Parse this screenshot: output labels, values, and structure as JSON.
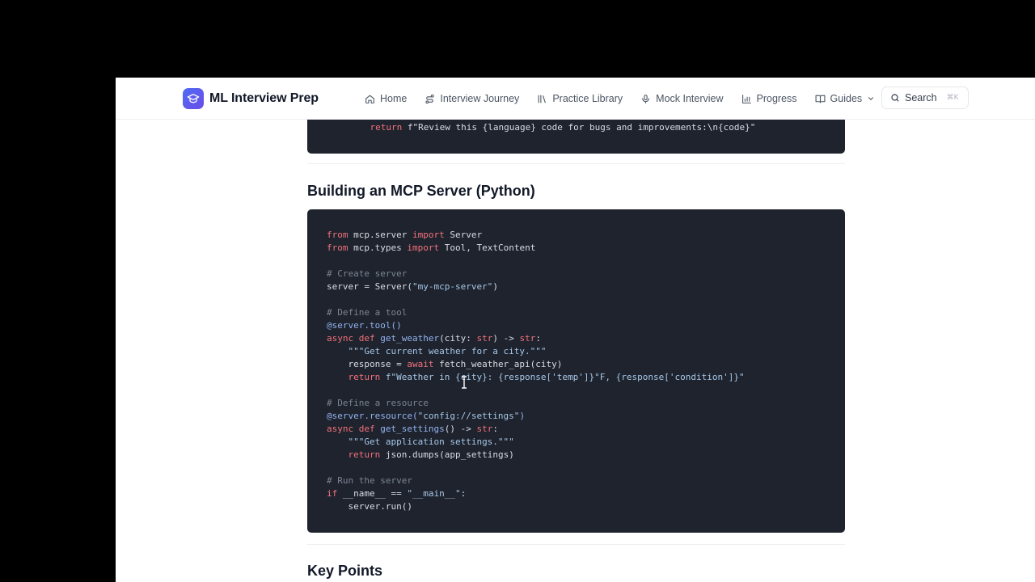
{
  "header": {
    "brand": "ML Interview Prep",
    "nav": [
      {
        "label": "Home",
        "icon": "home-icon"
      },
      {
        "label": "Interview Journey",
        "icon": "route-icon"
      },
      {
        "label": "Practice Library",
        "icon": "library-icon"
      },
      {
        "label": "Mock Interview",
        "icon": "microphone-icon"
      },
      {
        "label": "Progress",
        "icon": "bar-chart-icon"
      },
      {
        "label": "Guides",
        "icon": "book-open-icon"
      }
    ],
    "search_label": "Search",
    "search_shortcut": "⌘K"
  },
  "content": {
    "top_code_line": [
      {
        "t": "    "
      },
      {
        "t": "return",
        "c": "kw"
      },
      {
        "t": " f\"Review this {language} code for bugs and improvements:\\n{code}\""
      }
    ],
    "section_title": "Building an MCP Server (Python)",
    "code_lines": [
      [
        {
          "t": "from",
          "c": "kw"
        },
        {
          "t": " mcp.server "
        },
        {
          "t": "import",
          "c": "kw"
        },
        {
          "t": " Server"
        }
      ],
      [
        {
          "t": "from",
          "c": "kw"
        },
        {
          "t": " mcp.types "
        },
        {
          "t": "import",
          "c": "kw"
        },
        {
          "t": " Tool, TextContent"
        }
      ],
      [],
      [
        {
          "t": "# Create server",
          "c": "cm"
        }
      ],
      [
        {
          "t": "server = Server("
        },
        {
          "t": "\"my-mcp-server\"",
          "c": "st"
        },
        {
          "t": ")"
        }
      ],
      [],
      [
        {
          "t": "# Define a tool",
          "c": "cm"
        }
      ],
      [
        {
          "t": "@server.tool()",
          "c": "dc"
        }
      ],
      [
        {
          "t": "async",
          "c": "kw"
        },
        {
          "t": " "
        },
        {
          "t": "def",
          "c": "kw"
        },
        {
          "t": " "
        },
        {
          "t": "get_weather",
          "c": "dc"
        },
        {
          "t": "(city: "
        },
        {
          "t": "str",
          "c": "kw"
        },
        {
          "t": ") -> "
        },
        {
          "t": "str",
          "c": "kw"
        },
        {
          "t": ":"
        }
      ],
      [
        {
          "t": "    "
        },
        {
          "t": "\"\"\"Get current weather for a city.\"\"\"",
          "c": "st"
        }
      ],
      [
        {
          "t": "    response = "
        },
        {
          "t": "await",
          "c": "kw"
        },
        {
          "t": " fetch_weather_api(city)"
        }
      ],
      [
        {
          "t": "    "
        },
        {
          "t": "return",
          "c": "kw"
        },
        {
          "t": " "
        },
        {
          "t": "f\"Weather in {city}: {response['temp']}°F, {response['condition']}\"",
          "c": "st"
        }
      ],
      [],
      [
        {
          "t": "# Define a resource",
          "c": "cm"
        }
      ],
      [
        {
          "t": "@server.resource(",
          "c": "dc"
        },
        {
          "t": "\"config://settings\"",
          "c": "st"
        },
        {
          "t": ")",
          "c": "dc"
        }
      ],
      [
        {
          "t": "async",
          "c": "kw"
        },
        {
          "t": " "
        },
        {
          "t": "def",
          "c": "kw"
        },
        {
          "t": " "
        },
        {
          "t": "get_settings",
          "c": "dc"
        },
        {
          "t": "() -> "
        },
        {
          "t": "str",
          "c": "kw"
        },
        {
          "t": ":"
        }
      ],
      [
        {
          "t": "    "
        },
        {
          "t": "\"\"\"Get application settings.\"\"\"",
          "c": "st"
        }
      ],
      [
        {
          "t": "    "
        },
        {
          "t": "return",
          "c": "kw"
        },
        {
          "t": " json.dumps(app_settings)"
        }
      ],
      [],
      [
        {
          "t": "# Run the server",
          "c": "cm"
        }
      ],
      [
        {
          "t": "if",
          "c": "kw"
        },
        {
          "t": " __name__ == "
        },
        {
          "t": "\"__main__\"",
          "c": "st"
        },
        {
          "t": ":"
        }
      ],
      [
        {
          "t": "    server.run()"
        }
      ]
    ],
    "next_section_title": "Key Points"
  }
}
